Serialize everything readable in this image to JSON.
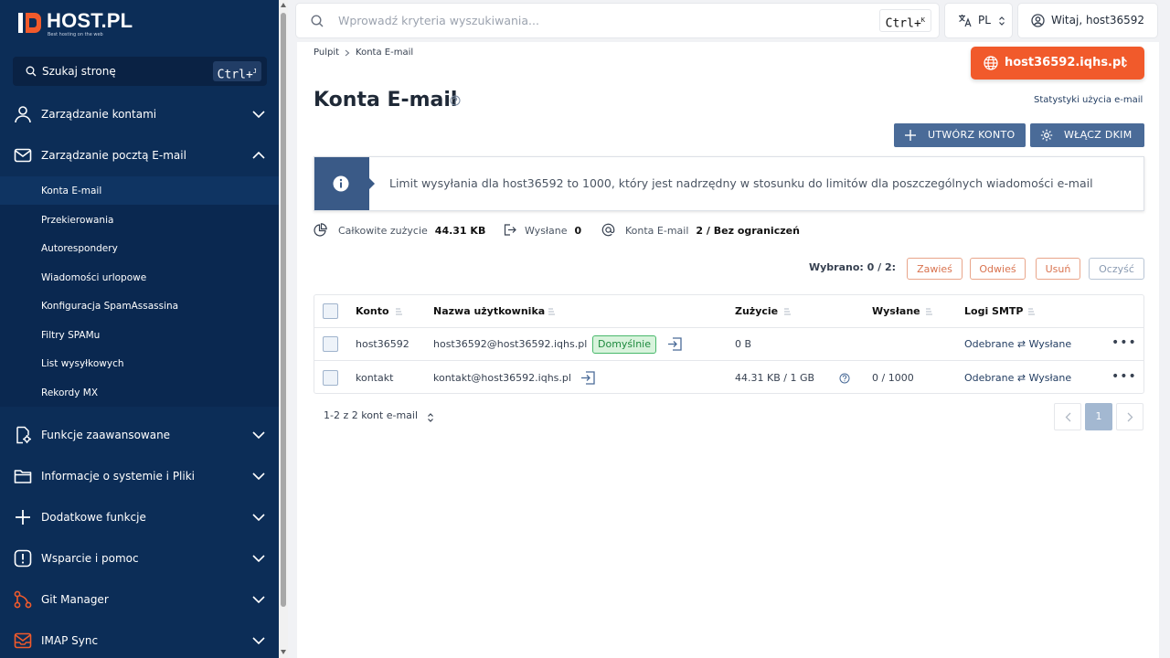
{
  "brand": {
    "name": "HOST.PL",
    "tagline": "Best hosting on the web",
    "accent": "#f15a2b",
    "sidebar_bg": "#0c2d57"
  },
  "sidebar": {
    "search_label": "Szukaj stronę",
    "search_shortcut": "Ctrl+",
    "search_shortcut_key": "J",
    "items": [
      {
        "label": "Zarządzanie kontami",
        "icon": "user-icon",
        "expanded": false
      },
      {
        "label": "Zarządzanie pocztą E-mail",
        "icon": "mail-icon",
        "expanded": true
      },
      {
        "label": "Funkcje zaawansowane",
        "icon": "doc-settings-icon",
        "expanded": false
      },
      {
        "label": "Informacje o systemie i Pliki",
        "icon": "folder-icon",
        "expanded": false
      },
      {
        "label": "Dodatkowe funkcje",
        "icon": "plus-icon",
        "expanded": false
      },
      {
        "label": "Wsparcie i pomoc",
        "icon": "alert-icon",
        "expanded": false
      },
      {
        "label": "Git Manager",
        "icon": "git-icon",
        "expanded": false
      },
      {
        "label": "IMAP Sync",
        "icon": "inbox-icon",
        "expanded": false
      }
    ],
    "subitems": [
      "Konta E-mail",
      "Przekierowania",
      "Autorespondery",
      "Wiadomości urlopowe",
      "Konfiguracja SpamAssassina",
      "Filtry SPAMu",
      "List wysyłkowych",
      "Rekordy MX"
    ]
  },
  "topbar": {
    "search_placeholder": "Wprowadź kryteria wyszukiwania...",
    "search_shortcut": "Ctrl+",
    "search_shortcut_key": "K",
    "language": "PL",
    "user": "Witaj, host36592"
  },
  "main": {
    "breadcrumb": [
      "Pulpit",
      "Konta E-mail"
    ],
    "domain": "host36592.iqhs.pl",
    "title": "Konta E-mail",
    "stats_link": "Statystyki użycia e-mail",
    "create_button": "UTWÓRZ KONTO",
    "dkim_button": "WŁĄCZ DKIM",
    "alert_text": "Limit wysyłania dla host36592 to 1000, który jest nadrzędny w stosunku do limitów dla poszczególnych wiadomości e-mail",
    "usage": {
      "total_label": "Całkowite zużycie",
      "total_value": "44.31 KB",
      "sent_label": "Wysłane",
      "sent_value": "0",
      "accounts_label": "Konta E-mail",
      "accounts_value": "2 / Bez ograniczeń"
    },
    "selected": "Wybrano: 0 / 2:",
    "actions": [
      "Zawieś",
      "Odwieś",
      "Usuń",
      "Oczyść"
    ],
    "table": {
      "columns": [
        "Konto",
        "Nazwa użytkownika",
        "Zużycie",
        "Wysłane",
        "Logi SMTP"
      ],
      "rows": [
        {
          "account": "host36592",
          "username": "host36592@host36592.iqhs.pl",
          "badge": "Domyślnie",
          "usage": "0 B",
          "sent": "",
          "smtp": "Odebrane ⇄ Wysłane"
        },
        {
          "account": "kontakt",
          "username": "kontakt@host36592.iqhs.pl",
          "badge": "",
          "usage": "44.31 KB / 1 GB",
          "sent": "0 / 1000",
          "smtp": "Odebrane ⇄ Wysłane"
        }
      ]
    },
    "footer_count": "1-2 z 2 kont e-mail",
    "page": "1"
  }
}
